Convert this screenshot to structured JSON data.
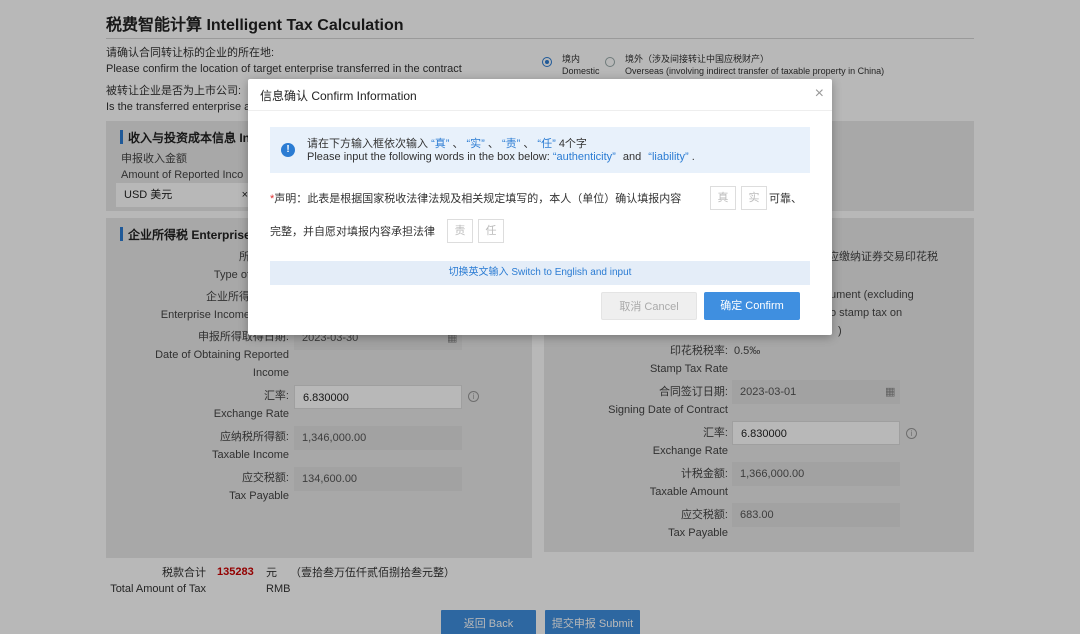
{
  "page": {
    "title": "税费智能计算 Intelligent Tax Calculation",
    "q1_cn": "请确认合同转让标的企业的所在地:",
    "q1_en": "Please confirm the location of target enterprise transferred in the contract",
    "domestic_cn": "境内",
    "domestic_en": "Domestic",
    "overseas_cn": "境外（涉及间接转让中国应税财产）",
    "overseas_en": "Overseas (involving indirect transfer of taxable property in China)",
    "q2_cn": "被转让企业是否为上市公司:",
    "q2_en": "Is the transferred enterprise a"
  },
  "income_panel": {
    "head": "收入与投资成本信息 In",
    "income_cn": "申报收入金额",
    "income_en": "Amount of Reported Inco",
    "currency": "USD 美元",
    "currency_clear": "×"
  },
  "cit_panel": {
    "head": "企业所得税 Enterprise",
    "type_cn": "所",
    "type_en": "Type of",
    "eit_cn": "企业所得",
    "eit_en": "Enterprise Income",
    "date_cn": "申报所得取得日期:",
    "date_en1": "Date of Obtaining Reported",
    "date_en2": "Income",
    "date_value": "2023-03-30",
    "rate_cn": "汇率:",
    "rate_en": "Exchange Rate",
    "rate_value": "6.830000",
    "taxable_cn": "应纳税所得额:",
    "taxable_en": "Taxable Income",
    "taxable_value": "1,346,000.00",
    "payable_cn": "应交税额:",
    "payable_en": "Tax Payable",
    "payable_value": "134,600.00"
  },
  "stamp_panel": {
    "head_tail": "应缴纳证券交易印花税",
    "doc_line1": "ument (excluding",
    "doc_line2": "o stamp tax on",
    "doc_line3": ")",
    "rate_cn": "印花税税率:",
    "rate_en": "Stamp Tax Rate",
    "rate_value": "0.5‰",
    "sign_cn": "合同签订日期:",
    "sign_en": "Signing Date of Contract",
    "sign_value": "2023-03-01",
    "ex_cn": "汇率:",
    "ex_en": "Exchange Rate",
    "ex_value": "6.830000",
    "amount_cn": "计税金额:",
    "amount_en": "Taxable Amount",
    "amount_value": "1,366,000.00",
    "payable_cn": "应交税额:",
    "payable_en": "Tax Payable",
    "payable_value": "683.00"
  },
  "total": {
    "label_cn": "税款合计",
    "label_en": "Total Amount of Tax",
    "value": "135283",
    "unit_cn": "元",
    "unit_en": "RMB",
    "words": "（壹拾叁万伍仟贰佰捌拾叁元整）"
  },
  "buttons": {
    "back": "返回 Back",
    "submit": "提交申报 Submit"
  },
  "dialog": {
    "title": "信息确认 Confirm Information",
    "close": "×",
    "info_icon": "!",
    "notice_cn_pre": "请在下方输入框依次输入",
    "w1": "“真”",
    "sep1": "、",
    "w2": "“实”",
    "sep2": "、",
    "w3": "“责”",
    "sep3": "、",
    "w4": "“任”",
    "notice_cn_post": "4个字",
    "notice_en_pre": "Please input the following words in the box below:",
    "w_en1": "“authenticity”",
    "and": "and",
    "w_en2": "“liability”",
    "dot": ".",
    "star": "*",
    "decl_line1": "声明：此表是根据国家税收法律法规及相关规定填写的，本人（单位）确认填报内容",
    "box1": "真",
    "box2": "实",
    "decl_mid": "可靠、",
    "decl_line2": "完整，并自愿对填报内容承担法律",
    "box3": "责",
    "box4": "任",
    "switch": "切换英文输入 Switch to English and input",
    "cancel": "取消 Cancel",
    "confirm": "确定 Confirm"
  }
}
